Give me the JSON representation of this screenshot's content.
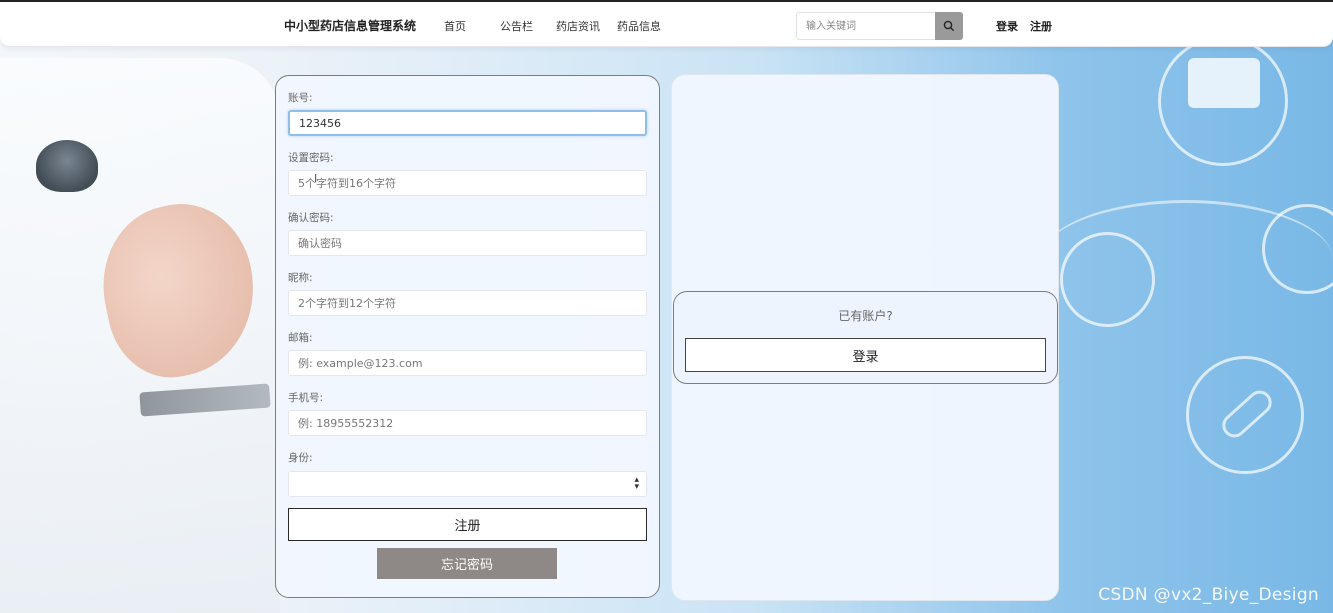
{
  "navbar": {
    "brand": "中小型药店信息管理系统",
    "links": [
      "首页",
      "公告栏",
      "药店资讯",
      "药品信息"
    ],
    "search_placeholder": "输入关键词",
    "login_label": "登录",
    "register_label": "注册"
  },
  "form": {
    "fields": [
      {
        "label": "账号:",
        "value": "123456",
        "placeholder": ""
      },
      {
        "label": "设置密码:",
        "value": "",
        "placeholder": "5个字符到16个字符"
      },
      {
        "label": "确认密码:",
        "value": "",
        "placeholder": "确认密码"
      },
      {
        "label": "昵称:",
        "value": "",
        "placeholder": "2个字符到12个字符"
      },
      {
        "label": "邮箱:",
        "value": "",
        "placeholder": "例: example@123.com"
      },
      {
        "label": "手机号:",
        "value": "",
        "placeholder": "例: 18955552312"
      }
    ],
    "identity_label": "身份:",
    "identity_value": "",
    "register_button": "注册",
    "forgot_button": "忘记密码"
  },
  "side": {
    "prompt": "已有账户?",
    "login_button": "登录"
  },
  "watermark": "CSDN @vx2_Biye_Design",
  "colors": {
    "accent_focus": "#8fbfe8",
    "forgot_button_bg": "#8e8886",
    "panel_bg": "#f1f7ff",
    "panel_border": "#7d7b80"
  },
  "icons": {
    "search": "search-icon",
    "select_arrows": "sort-arrows-icon"
  }
}
